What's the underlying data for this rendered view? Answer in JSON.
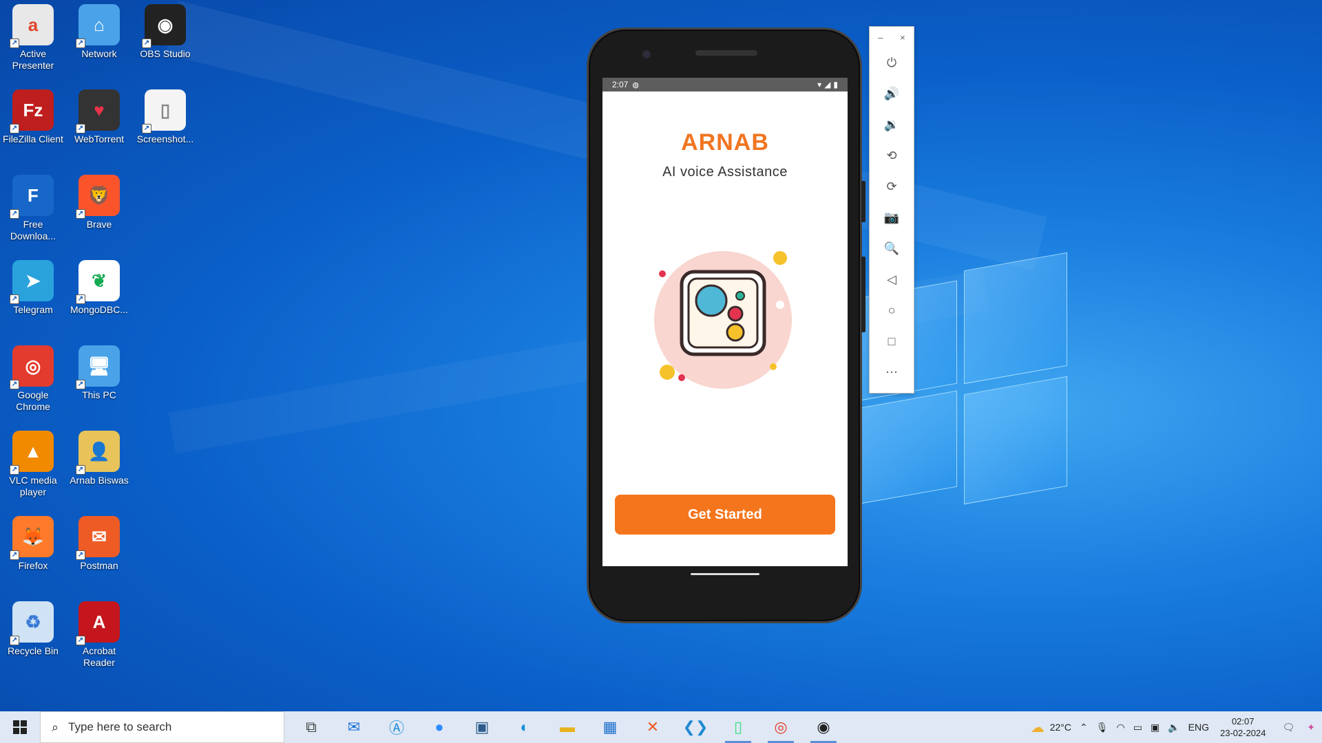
{
  "desktop": {
    "icons": [
      {
        "label": "Active Presenter",
        "glyph": "a",
        "color": "#e8e8e8",
        "fg": "#e0462a"
      },
      {
        "label": "Network",
        "glyph": "⌂",
        "color": "#4aa3e8",
        "fg": "#fff"
      },
      {
        "label": "OBS Studio",
        "glyph": "◉",
        "color": "#222",
        "fg": "#fff"
      },
      {
        "label": "FileZilla Client",
        "glyph": "Fz",
        "color": "#bf1e1e",
        "fg": "#fff"
      },
      {
        "label": "WebTorrent",
        "glyph": "♥",
        "color": "#333",
        "fg": "#e8334a"
      },
      {
        "label": "Screenshot...",
        "glyph": "▯",
        "color": "#f4f4f4",
        "fg": "#888"
      },
      {
        "label": "Free Downloa...",
        "glyph": "F",
        "color": "#1767c8",
        "fg": "#fff"
      },
      {
        "label": "Brave",
        "glyph": "🦁",
        "color": "#fb542b",
        "fg": "#fff"
      },
      {
        "label": "Telegram",
        "glyph": "➤",
        "color": "#2aa3dd",
        "fg": "#fff"
      },
      {
        "label": "MongoDBC...",
        "glyph": "❦",
        "color": "#fff",
        "fg": "#13aa52"
      },
      {
        "label": "Google Chrome",
        "glyph": "◎",
        "color": "#e33b2e",
        "fg": "#fff"
      },
      {
        "label": "This PC",
        "glyph": "🖥",
        "color": "#4aa3e8",
        "fg": "#fff"
      },
      {
        "label": "VLC media player",
        "glyph": "▲",
        "color": "#f28a00",
        "fg": "#fff"
      },
      {
        "label": "Arnab Biswas",
        "glyph": "👤",
        "color": "#e8c35a",
        "fg": "#333"
      },
      {
        "label": "Firefox",
        "glyph": "🦊",
        "color": "#ff7a2a",
        "fg": "#fff"
      },
      {
        "label": "Postman",
        "glyph": "✉",
        "color": "#ef5b25",
        "fg": "#fff"
      },
      {
        "label": "Recycle Bin",
        "glyph": "♻",
        "color": "#cfe3f5",
        "fg": "#3a7bd5"
      },
      {
        "label": "Acrobat Reader",
        "glyph": "A",
        "color": "#c4161c",
        "fg": "#fff"
      }
    ]
  },
  "phone": {
    "status_time": "2:07",
    "app_title": "ARNAB",
    "app_subtitle": "AI voice Assistance",
    "button_label": "Get Started"
  },
  "emulator_toolbar": {
    "minimize": "–",
    "close": "×",
    "tools": [
      {
        "name": "power-icon",
        "glyph": "⏻"
      },
      {
        "name": "volume-up-icon",
        "glyph": "🔊"
      },
      {
        "name": "volume-down-icon",
        "glyph": "🔉"
      },
      {
        "name": "rotate-left-icon",
        "glyph": "⟲"
      },
      {
        "name": "rotate-right-icon",
        "glyph": "⟳"
      },
      {
        "name": "camera-icon",
        "glyph": "📷"
      },
      {
        "name": "zoom-icon",
        "glyph": "🔍"
      },
      {
        "name": "back-icon",
        "glyph": "◁"
      },
      {
        "name": "home-icon",
        "glyph": "○"
      },
      {
        "name": "overview-icon",
        "glyph": "□"
      },
      {
        "name": "more-icon",
        "glyph": "⋯"
      }
    ]
  },
  "taskbar": {
    "search_placeholder": "Type here to search",
    "weather": "22°C",
    "language": "ENG",
    "time": "02:07",
    "date": "23-02-2024"
  }
}
